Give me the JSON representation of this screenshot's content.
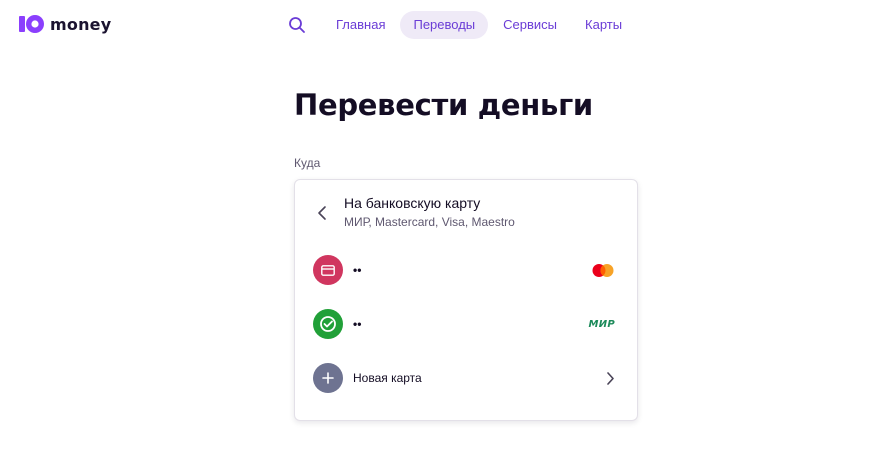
{
  "brand": {
    "name": "money",
    "accent": "#8b3ffd"
  },
  "nav": {
    "items": [
      {
        "label": "Главная",
        "active": false
      },
      {
        "label": "Переводы",
        "active": true
      },
      {
        "label": "Сервисы",
        "active": false
      },
      {
        "label": "Карты",
        "active": false
      }
    ]
  },
  "page": {
    "title": "Перевести деньги",
    "section_label": "Куда"
  },
  "card": {
    "title": "На банковскую карту",
    "subtitle": "МИР, Mastercard, Visa, Maestro",
    "rows": [
      {
        "label": "••",
        "icon": "card-icon",
        "icon_color": "#d0365f",
        "network": "mastercard"
      },
      {
        "label": "••",
        "icon": "check-icon",
        "icon_color": "#21a038",
        "network": "МИР"
      },
      {
        "label": "Новая карта",
        "icon": "plus-icon",
        "icon_color": "#6e7391",
        "network": "chevron"
      }
    ]
  }
}
